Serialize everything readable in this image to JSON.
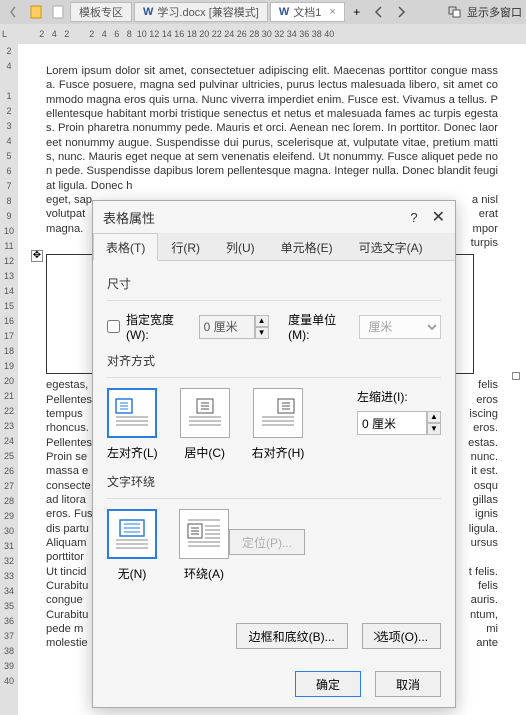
{
  "toolbar": {
    "tab1": "模板专区",
    "tab2": "学习.docx [兼容模式]",
    "tab3": "文档1",
    "multi_window": "显示多窗口"
  },
  "ruler_h": [
    "2",
    "4",
    "2",
    "",
    "2",
    "4",
    "6",
    "8",
    "10",
    "12",
    "14",
    "16",
    "18",
    "20",
    "22",
    "24",
    "26",
    "28",
    "30",
    "32",
    "34",
    "36",
    "38",
    "40"
  ],
  "ruler_v": [
    "2",
    "4",
    "",
    "1",
    "2",
    "3",
    "4",
    "5",
    "6",
    "7",
    "8",
    "9",
    "10",
    "11",
    "12",
    "13",
    "14",
    "15",
    "16",
    "17",
    "18",
    "19",
    "20",
    "21",
    "22",
    "23",
    "24",
    "25",
    "26",
    "27",
    "28",
    "29",
    "30",
    "31",
    "32",
    "33",
    "34",
    "35",
    "36",
    "37",
    "38",
    "39",
    "40"
  ],
  "doc": {
    "p1": "Lorem ipsum dolor sit amet, consectetuer adipiscing elit. Maecenas porttitor congue massa. Fusce posuere, magna sed pulvinar ultricies, purus lectus malesuada libero, sit amet commodo magna eros quis urna. Nunc viverra imperdiet enim. Fusce est. Vivamus a tellus. Pellentesque habitant morbi tristique senectus et netus et malesuada fames ac turpis egestas. Proin pharetra nonummy pede. Mauris et orci. Aenean nec lorem. In porttitor. Donec laoreet nonummy augue. Suspendisse dui purus, scelerisque at, vulputate vitae, pretium mattis, nunc. Mauris eget neque at sem venenatis eleifend. Ut nonummy. Fusce aliquet pede non pede. Suspendisse dapibus lorem pellentesque magna. Integer nulla. Donec blandit feugiat ligula. Donec h",
    "p1_tail1": "a nisl",
    "p1_tail2": "   erat",
    "p1_tail3": "mpor",
    "p1_tail4": "turpis",
    "frag_before_table": "eget, sap",
    "frag_before_table2": "volutpat",
    "frag_before_table3": "magna. ",
    "p2_first": "egestas,",
    "p2_first_tail": " felis",
    "p2_lines": [
      "Pellentes",
      " eros",
      "tempus",
      " iscing",
      "rhoncus.",
      " eros.",
      "Pellentes",
      "estas.",
      "Proin se",
      " nunc.",
      "massa e",
      "it est.",
      "consecte",
      "osqu",
      "ad litora",
      "gillas",
      "eros. Fus",
      "ignis",
      "dis partu",
      "ligula.",
      "Aliquam",
      "ursus",
      "porttitor",
      "          ",
      "Ut  tincid",
      "t felis.",
      "Curabitu",
      " felis",
      "congue",
      "auris.",
      "Curabitu",
      "ntum,",
      "pede m",
      "   mi",
      "molestie",
      " ante"
    ],
    "p3": ""
  },
  "dialog": {
    "title": "表格属性",
    "tabs": [
      "表格(T)",
      "行(R)",
      "列(U)",
      "单元格(E)",
      "可选文字(A)"
    ],
    "size_label": "尺寸",
    "specify_width": "指定宽度(W):",
    "width_value": "0 厘米",
    "unit_label": "度量单位(M):",
    "unit_value": "厘米",
    "align_label": "对齐方式",
    "align_left": "左对齐(L)",
    "align_center": "居中(C)",
    "align_right": "右对齐(H)",
    "indent_label": "左缩进(I):",
    "indent_value": "0 厘米",
    "wrap_label": "文字环绕",
    "wrap_none": "无(N)",
    "wrap_around": "环绕(A)",
    "position_btn": "定位(P)...",
    "border_btn": "边框和底纹(B)...",
    "options_btn": "选项(O)...",
    "ok": "确定",
    "cancel": "取消"
  }
}
